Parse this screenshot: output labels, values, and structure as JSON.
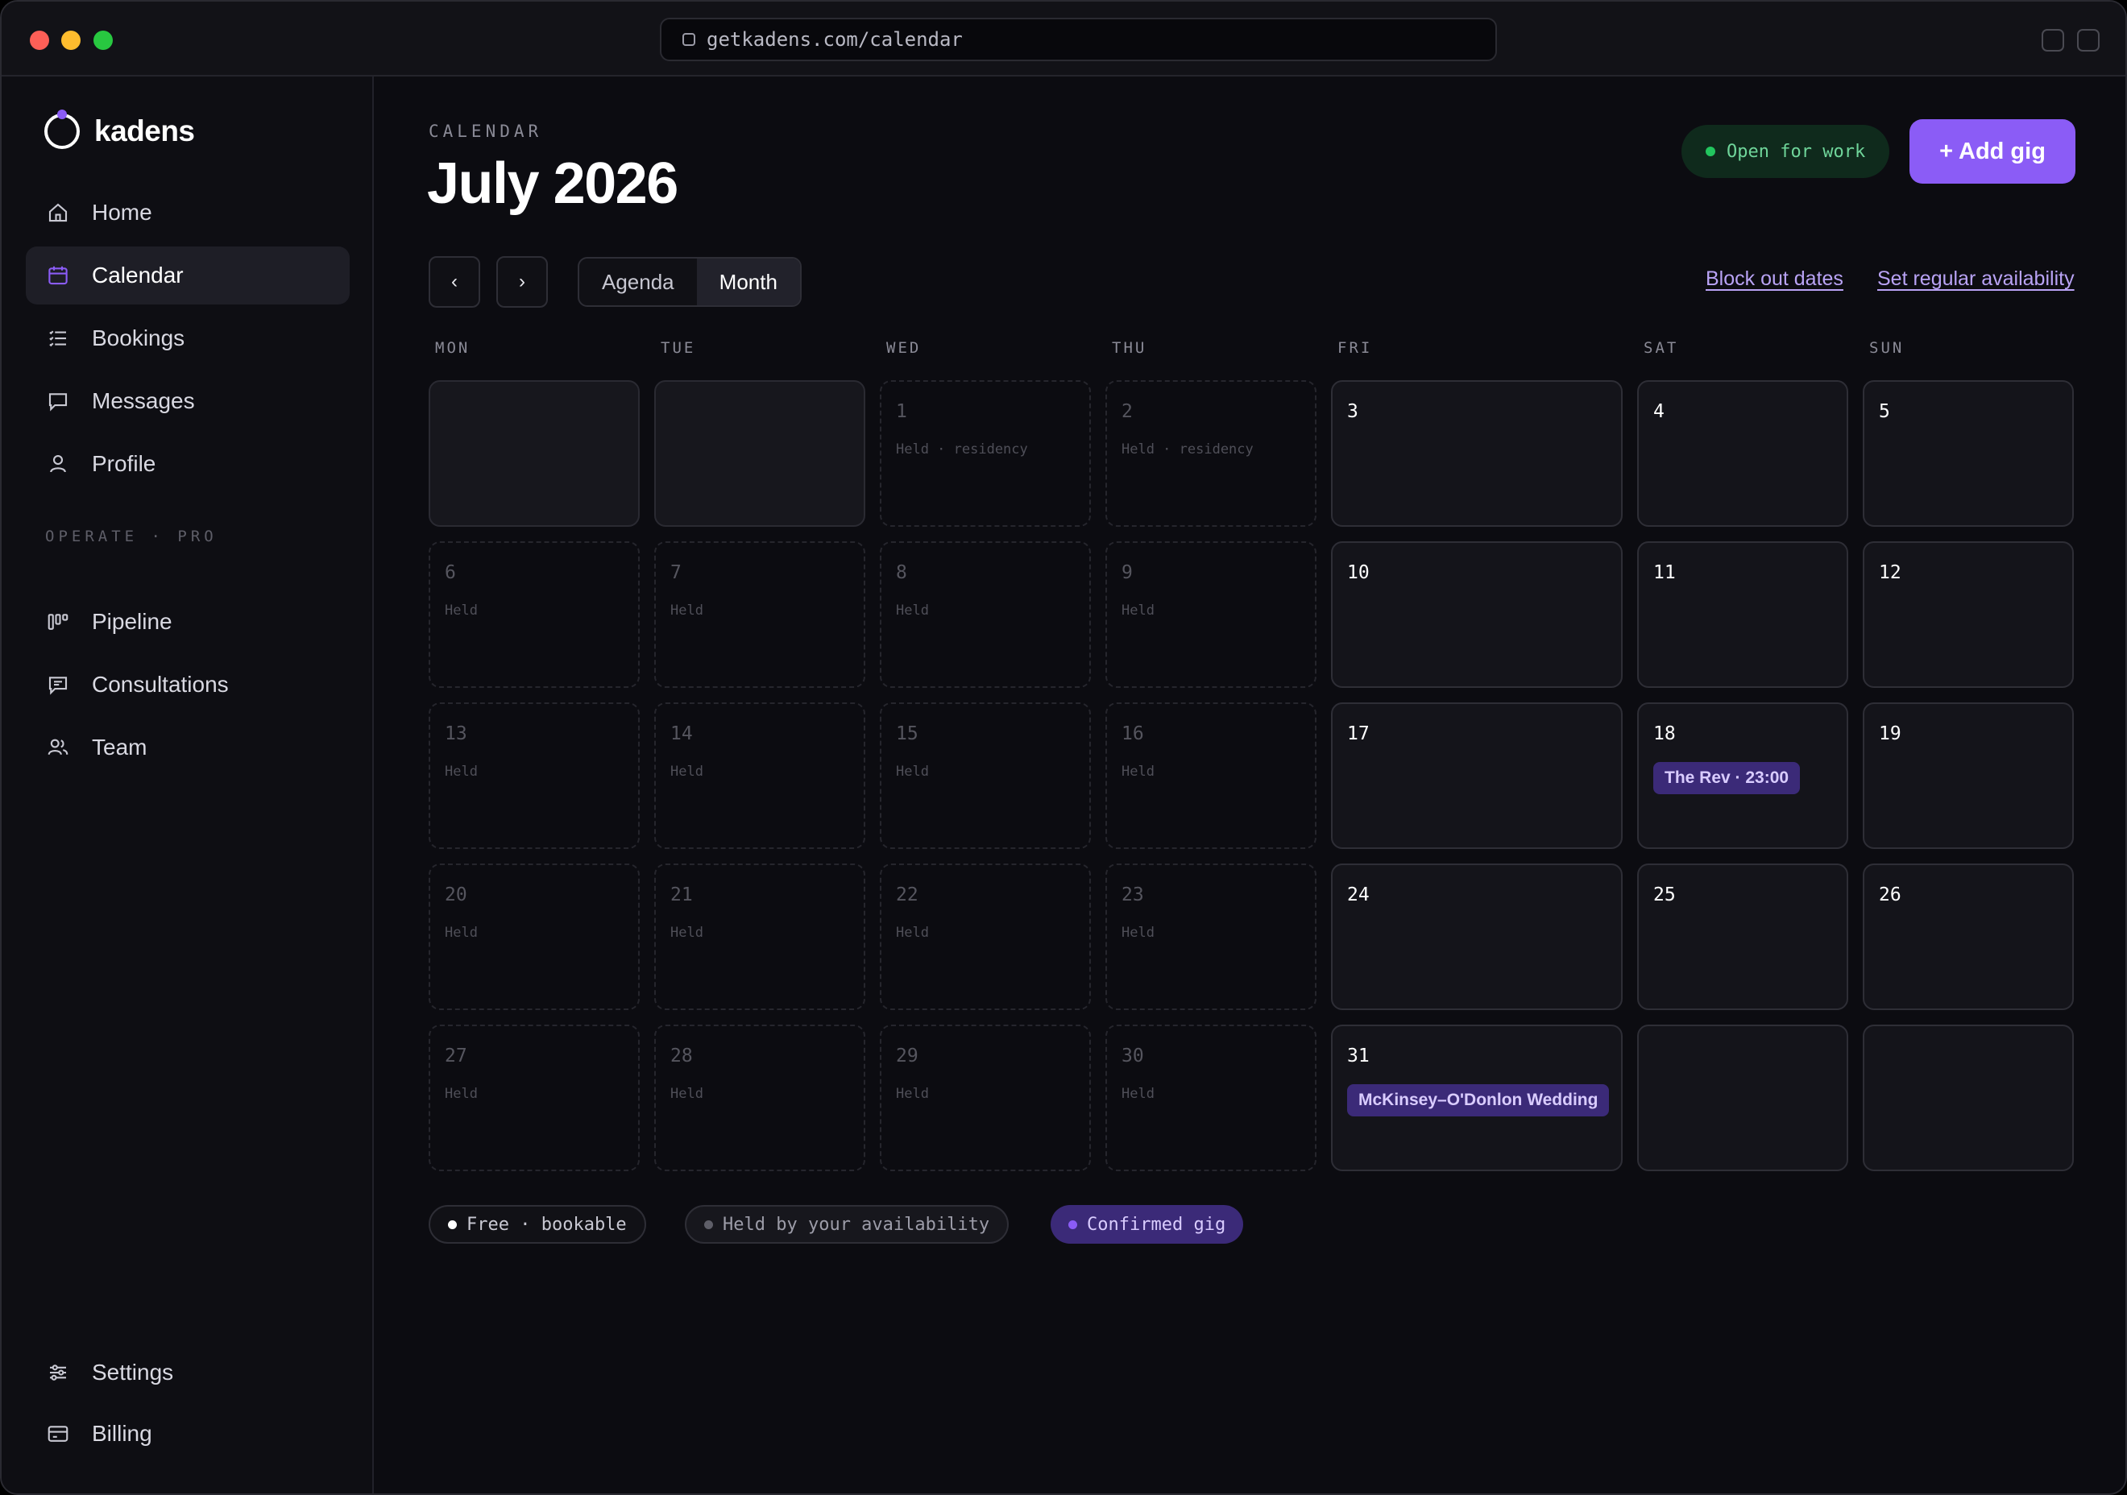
{
  "browser": {
    "url": "getkadens.com/calendar"
  },
  "brand": {
    "name": "kadens"
  },
  "sidebar": {
    "items": [
      {
        "label": "Home",
        "icon": "home-icon"
      },
      {
        "label": "Calendar",
        "icon": "calendar-icon",
        "active": true
      },
      {
        "label": "Bookings",
        "icon": "list-icon"
      },
      {
        "label": "Messages",
        "icon": "message-icon"
      },
      {
        "label": "Profile",
        "icon": "user-icon"
      }
    ],
    "section_label": "OPERATE · PRO",
    "pro_items": [
      {
        "label": "Pipeline",
        "icon": "pipeline-icon"
      },
      {
        "label": "Consultations",
        "icon": "consultation-icon"
      },
      {
        "label": "Team",
        "icon": "team-icon"
      }
    ],
    "bottom_items": [
      {
        "label": "Settings",
        "icon": "sliders-icon"
      },
      {
        "label": "Billing",
        "icon": "card-icon"
      }
    ]
  },
  "header": {
    "eyebrow": "CALENDAR",
    "title": "July 2026",
    "status": "Open for work",
    "add_button": "+ Add gig"
  },
  "toolbar": {
    "prev": "‹",
    "next": "›",
    "views": [
      "Agenda",
      "Month"
    ],
    "active_view": "Month",
    "block_out": "Block out dates",
    "regular_availability": "Set regular availability"
  },
  "weekdays": [
    "MON",
    "TUE",
    "WED",
    "THU",
    "FRI",
    "SAT",
    "SUN"
  ],
  "weeks": [
    [
      {
        "day": "",
        "state": "blank"
      },
      {
        "day": "",
        "state": "blank"
      },
      {
        "day": "1",
        "state": "held",
        "note": "Held · residency"
      },
      {
        "day": "2",
        "state": "held",
        "note": "Held · residency"
      },
      {
        "day": "3",
        "state": "free"
      },
      {
        "day": "4",
        "state": "free"
      },
      {
        "day": "5",
        "state": "free"
      }
    ],
    [
      {
        "day": "6",
        "state": "held",
        "note": "Held"
      },
      {
        "day": "7",
        "state": "held",
        "note": "Held"
      },
      {
        "day": "8",
        "state": "held",
        "note": "Held"
      },
      {
        "day": "9",
        "state": "held",
        "note": "Held"
      },
      {
        "day": "10",
        "state": "free"
      },
      {
        "day": "11",
        "state": "free"
      },
      {
        "day": "12",
        "state": "free"
      }
    ],
    [
      {
        "day": "13",
        "state": "held",
        "note": "Held"
      },
      {
        "day": "14",
        "state": "held",
        "note": "Held"
      },
      {
        "day": "15",
        "state": "held",
        "note": "Held"
      },
      {
        "day": "16",
        "state": "held",
        "note": "Held"
      },
      {
        "day": "17",
        "state": "free"
      },
      {
        "day": "18",
        "state": "free",
        "gig": "The Rev · 23:00"
      },
      {
        "day": "19",
        "state": "free"
      }
    ],
    [
      {
        "day": "20",
        "state": "held",
        "note": "Held"
      },
      {
        "day": "21",
        "state": "held",
        "note": "Held"
      },
      {
        "day": "22",
        "state": "held",
        "note": "Held"
      },
      {
        "day": "23",
        "state": "held",
        "note": "Held"
      },
      {
        "day": "24",
        "state": "free"
      },
      {
        "day": "25",
        "state": "free"
      },
      {
        "day": "26",
        "state": "free"
      }
    ],
    [
      {
        "day": "27",
        "state": "held",
        "note": "Held"
      },
      {
        "day": "28",
        "state": "held",
        "note": "Held"
      },
      {
        "day": "29",
        "state": "held",
        "note": "Held"
      },
      {
        "day": "30",
        "state": "held",
        "note": "Held"
      },
      {
        "day": "31",
        "state": "free",
        "gig": "McKinsey–O'Donlon Wedding"
      },
      {
        "day": "",
        "state": "free"
      },
      {
        "day": "",
        "state": "free"
      }
    ]
  ],
  "legend": {
    "free": "Free · bookable",
    "held": "Held by your availability",
    "confirmed": "Confirmed gig"
  },
  "colors": {
    "accent": "#8b5cf6",
    "status": "#22c55e",
    "background": "#0c0c11"
  }
}
